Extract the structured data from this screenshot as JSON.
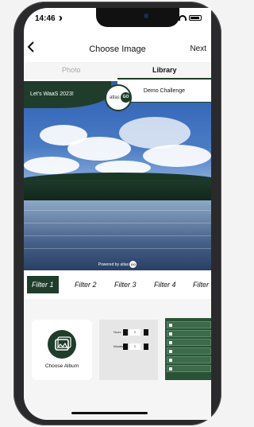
{
  "status": {
    "time": "14:46"
  },
  "nav": {
    "title": "Choose Image",
    "next_label": "Next"
  },
  "tabs": [
    {
      "label": "Photo",
      "active": false
    },
    {
      "label": "Library",
      "active": true
    }
  ],
  "banner": {
    "left_text": "Let's WaaS 2023!",
    "right_text": "Demo Challenge",
    "badge_word": "atlas",
    "badge_go": "GO"
  },
  "watermark": {
    "text": "Powered by atlas",
    "go": "GO"
  },
  "filters": [
    {
      "label": "Filter 1",
      "active": true
    },
    {
      "label": "Filter 2",
      "active": false
    },
    {
      "label": "Filter 3",
      "active": false
    },
    {
      "label": "Filter 4",
      "active": false
    },
    {
      "label": "Filter",
      "active": false
    }
  ],
  "album": {
    "label": "Choose Album"
  },
  "thumb_form": {
    "rows": [
      {
        "label": "Hours",
        "value": "0"
      },
      {
        "label": "Minutes",
        "value": "0"
      }
    ]
  },
  "colors": {
    "brand_green": "#1f3d2a",
    "inactive_tab": "#aaaaaa"
  },
  "icons": {
    "back": "chevron-left-icon",
    "album": "photo-album-icon"
  }
}
